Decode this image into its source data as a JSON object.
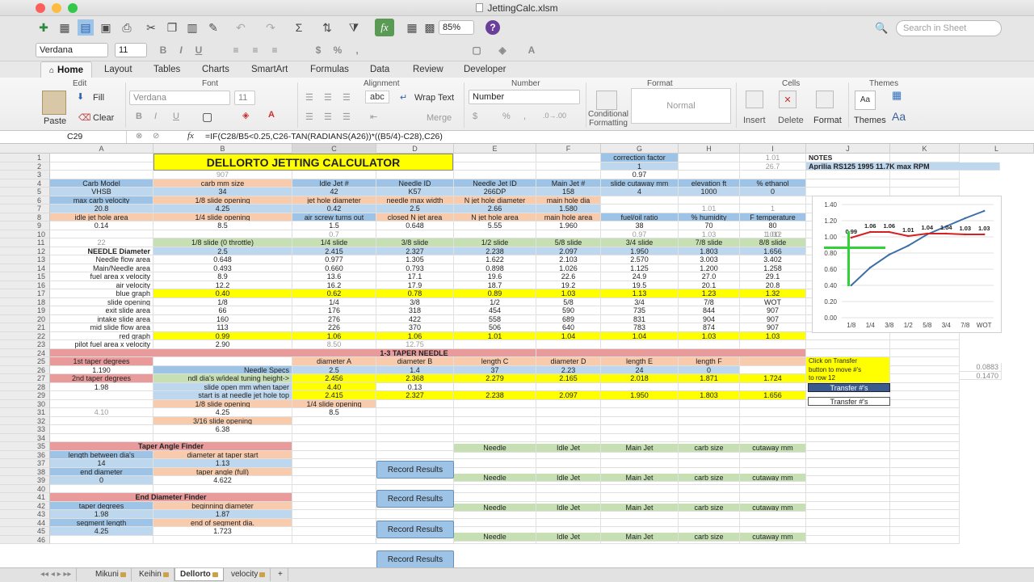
{
  "window": {
    "title": "JettingCalc.xlsm"
  },
  "colors": {
    "close": "#fc605c",
    "minimize": "#fdbc40",
    "maximize": "#34c84a"
  },
  "toolbar": {
    "zoom": "85%",
    "search_placeholder": "Search in Sheet",
    "help": "?"
  },
  "format_bar": {
    "font": "Verdana",
    "size": "11"
  },
  "tabs": [
    "Home",
    "Layout",
    "Tables",
    "Charts",
    "SmartArt",
    "Formulas",
    "Data",
    "Review",
    "Developer"
  ],
  "ribbon": {
    "edit": "Edit",
    "fill": "Fill",
    "clear": "Clear",
    "paste": "Paste",
    "font": "Font",
    "font_name": "Verdana",
    "font_size": "11",
    "alignment": "Alignment",
    "wrap_text": "Wrap Text",
    "merge": "Merge",
    "abc": "abc",
    "number": "Number",
    "number_format": "Number",
    "format": "Format",
    "normal": "Normal",
    "conditional": "Conditional",
    "formatting": "Formatting",
    "cells": "Cells",
    "insert": "Insert",
    "delete": "Delete",
    "format_btn": "Format",
    "themes": "Themes",
    "themes_btn": "Themes",
    "aa": "Aa"
  },
  "formula_bar": {
    "cell": "C29",
    "fx": "fx",
    "formula": "=IF(C28/B5<0.25,C26-TAN(RADIANS(A26))*((B5/4)-C28),C26)"
  },
  "columns": [
    "A",
    "B",
    "C",
    "D",
    "E",
    "F",
    "G",
    "H",
    "I",
    "J",
    "K",
    "L"
  ],
  "sheet": {
    "title": "DELLORTO JETTING CALCULATOR",
    "notes": "NOTES",
    "notes_bike": "Aprilia RS125 1995  11.7K max RPM",
    "r1": {
      "g": "correction factor",
      "i": "1.01"
    },
    "r2": {
      "g": "1",
      "i": "26.7"
    },
    "r3": {
      "b": "907",
      "g": "0.97"
    },
    "r4": [
      "Carb Model",
      "carb mm size",
      "Idle Jet #",
      "Needle ID",
      "Needle Jet ID",
      "Main Jet #",
      "slide cutaway mm",
      "elevation ft",
      "% ethanol"
    ],
    "r5": [
      "VHSB",
      "34",
      "42",
      "K57",
      "266DP",
      "158",
      "4",
      "1000",
      "0"
    ],
    "r6": [
      "max carb velocity",
      "1/8 slide opening",
      "jet hole diameter",
      "needle max width",
      "N jet hole diameter",
      "main hole dia",
      "",
      "",
      ""
    ],
    "r7": [
      "20.8",
      "4.25",
      "0.42",
      "2.5",
      "2.66",
      "1.580",
      "",
      "1.01",
      "1"
    ],
    "r8": [
      "idle jet hole area",
      "1/4 slide opening",
      "air screw turns out",
      "closed N jet area",
      "N jet hole area",
      "main hole area",
      "fuel/oil ratio",
      "% humidity",
      "F temperature"
    ],
    "r9": [
      "0.14",
      "8.5",
      "1.5",
      "0.648",
      "5.55",
      "1.960",
      "38",
      "70",
      "80"
    ],
    "r9b": [
      "",
      "",
      "",
      "",
      "",
      "",
      "0.97",
      "1.03",
      "1.00"
    ],
    "r10": {
      "c": "0.7",
      "i": "1.012"
    },
    "r11": [
      "22",
      "1/8 slide (0 throttle)",
      "1/4 slide",
      "3/8 slide",
      "1/2 slide",
      "5/8 slide",
      "3/4 slide",
      "7/8 slide",
      "8/8 slide"
    ],
    "r12": [
      "NEEDLE Diameter",
      "2.5",
      "2.415",
      "2.327",
      "2.238",
      "2.097",
      "1.950",
      "1.803",
      "1.656"
    ],
    "r13": [
      "Needle flow area",
      "0.648",
      "0.977",
      "1.305",
      "1.622",
      "2.103",
      "2.570",
      "3.003",
      "3.402"
    ],
    "r14": [
      "Main/Needle area",
      "0.493",
      "0.660",
      "0.793",
      "0.898",
      "1.026",
      "1.125",
      "1.200",
      "1.258"
    ],
    "r15": [
      "fuel area x velocity",
      "8.9",
      "13.6",
      "17.1",
      "19.6",
      "22.6",
      "24.9",
      "27.0",
      "29.1"
    ],
    "r16": [
      "air velocity",
      "12.2",
      "16.2",
      "17.9",
      "18.7",
      "19.2",
      "19.5",
      "20.1",
      "20.8"
    ],
    "r17": [
      "blue graph",
      "0.40",
      "0.62",
      "0.78",
      "0.89",
      "1.03",
      "1.13",
      "1.23",
      "1.32"
    ],
    "r18": [
      "slide opening",
      "1/8",
      "1/4",
      "3/8",
      "1/2",
      "5/8",
      "3/4",
      "7/8",
      "WOT"
    ],
    "r19": [
      "exit slide area",
      "66",
      "176",
      "318",
      "454",
      "590",
      "735",
      "844",
      "907"
    ],
    "r20": [
      "intake slide area",
      "160",
      "276",
      "422",
      "558",
      "689",
      "831",
      "904",
      "907"
    ],
    "r21": [
      "mid slide flow area",
      "113",
      "226",
      "370",
      "506",
      "640",
      "783",
      "874",
      "907"
    ],
    "r22": [
      "red graph",
      "0.99",
      "1.06",
      "1.06",
      "1.01",
      "1.04",
      "1.04",
      "1.03",
      "1.03"
    ],
    "r23": [
      "pilot fuel area x velocity",
      "2.90",
      "8.50",
      "12.75"
    ],
    "r24": "1-3 TAPER NEEDLE",
    "r25": [
      "1st taper degrees",
      "",
      "diameter A",
      "diameter B",
      "length C",
      "diameter D",
      "length E",
      "length F"
    ],
    "r26": [
      "1.190",
      "Needle Specs",
      "2.5",
      "1.4",
      "37",
      "2.23",
      "24",
      "0"
    ],
    "r27": [
      "2nd taper degrees",
      "ndl dia's w/ideal tuning height->",
      "2.456",
      "2.368",
      "2.279",
      "2.165",
      "2.018",
      "1.871",
      "1.724"
    ],
    "r28": [
      "1.98",
      "slide open mm when taper",
      "4.40",
      "0.13"
    ],
    "r29": [
      "start is at needle jet hole top",
      "2.415",
      "2.327",
      "2.238",
      "2.097",
      "1.950",
      "1.803",
      "1.656"
    ],
    "r30": [
      "1/8 slide opening",
      "1/4 slide opening"
    ],
    "r31": [
      "4.10",
      "4.25",
      "8.5"
    ],
    "r32": "3/16 slide opening",
    "r33": "6.38",
    "transfer_note": [
      "Click on Transfer",
      "button to move #'s",
      "to row 12"
    ],
    "transfer_btn": "Transfer #'s",
    "l25": "0.0883",
    "l26": "0.1470",
    "taper_finder": "Taper Angle Finder",
    "tf_h1": [
      "length between dia's",
      "diameter at taper start"
    ],
    "tf_v1": [
      "14",
      "1.13"
    ],
    "tf_h2": [
      "end diameter",
      "taper angle (full)"
    ],
    "tf_v2": [
      "0",
      "4.622"
    ],
    "end_finder": "End Diameter Finder",
    "ef_h1": [
      "taper degrees",
      "beginning diameter"
    ],
    "ef_v1": [
      "1.98",
      "1.87"
    ],
    "ef_h2": [
      "segment length",
      "end of segment dia."
    ],
    "ef_v2": [
      "4.25",
      "1.723"
    ],
    "record_headers": [
      "Needle",
      "Idle Jet",
      "Main Jet",
      "carb size",
      "cutaway mm"
    ],
    "record_btn": "Record Results"
  },
  "chart_data": {
    "type": "line",
    "categories": [
      "1/8",
      "1/4",
      "3/8",
      "1/2",
      "5/8",
      "3/4",
      "7/8",
      "WOT"
    ],
    "ylim": [
      0,
      1.4
    ],
    "yticks": [
      "0.00",
      "0.20",
      "0.40",
      "0.60",
      "0.80",
      "1.00",
      "1.20",
      "1.40"
    ],
    "series": [
      {
        "values": [
          0.4,
          0.62,
          0.78,
          0.89,
          1.03,
          1.13,
          1.23,
          1.32
        ],
        "color": "#3c6ea8"
      },
      {
        "values": [
          0.99,
          1.06,
          1.06,
          1.01,
          1.04,
          1.04,
          1.03,
          1.03
        ],
        "color": "#d42020",
        "labels": [
          "0.99",
          "1.06",
          "1.06",
          "1.01",
          "1.04",
          "1.04",
          "1.03",
          "1.03"
        ]
      }
    ]
  },
  "sheet_tabs": [
    "Mikuni",
    "Keihin",
    "Dellorto",
    "velocity"
  ]
}
